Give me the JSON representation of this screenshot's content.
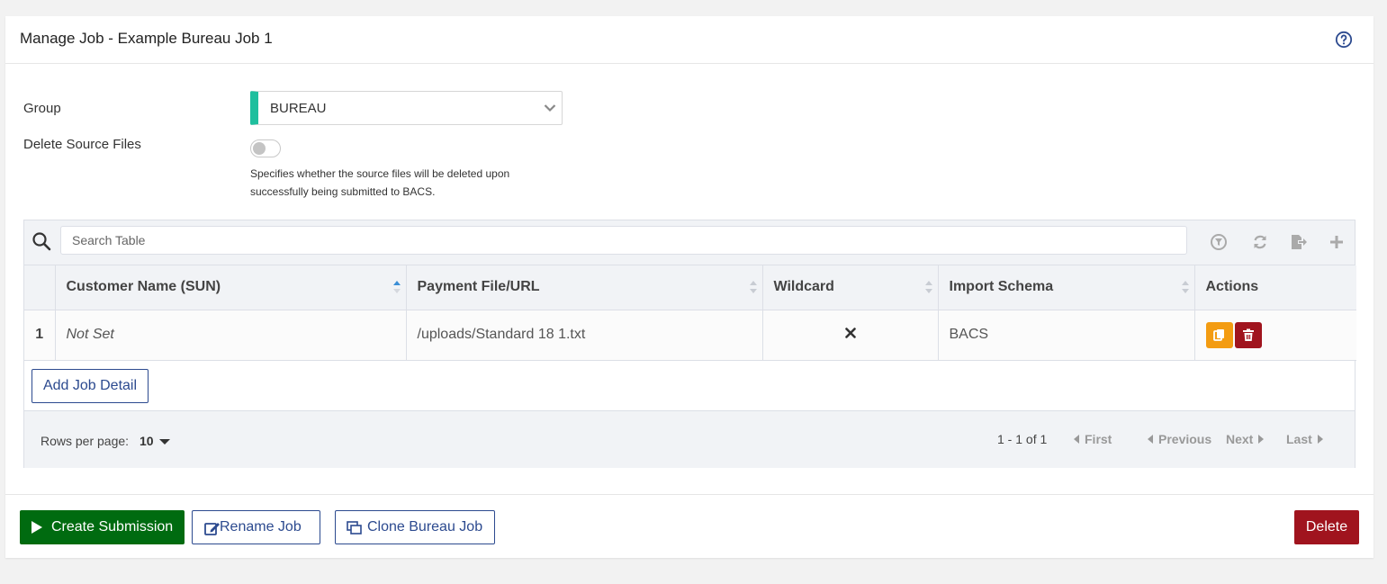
{
  "header": {
    "title": "Manage Job - Example Bureau Job 1",
    "help_icon": "question-circle-icon"
  },
  "form": {
    "group_label": "Group",
    "group_value": "BUREAU",
    "group_accent": "#1fbf9e",
    "delete_source_label": "Delete Source Files",
    "delete_source_enabled": false,
    "delete_source_help": "Specifies whether the source files will be deleted upon successfully being submitted to BACS."
  },
  "table": {
    "search_placeholder": "Search Table",
    "toolbar_icons": [
      "clear-filter-icon",
      "refresh-icon",
      "export-icon",
      "add-icon"
    ],
    "columns": [
      "",
      "Customer Name (SUN)",
      "Payment File/URL",
      "Wildcard",
      "Import Schema",
      "Actions"
    ],
    "rows": [
      {
        "index": "1",
        "customer": "Not Set",
        "payment_file": "/uploads/Standard 18 1.txt",
        "wildcard": "✕",
        "schema": "BACS"
      }
    ],
    "add_label": "Add Job Detail",
    "rows_per_page_label": "Rows per page:",
    "rows_per_page_value": "10",
    "page_info": "1 - 1 of 1",
    "first": "First",
    "previous": "Previous",
    "next": "Next",
    "last": "Last"
  },
  "footer": {
    "create_submission": "Create Submission",
    "rename_job": "Rename Job",
    "clone_job": "Clone Bureau Job",
    "delete": "Delete"
  },
  "colors": {
    "primary_green": "#006b10",
    "danger_red": "#a0141e",
    "copy_orange": "#f39c12",
    "outline_blue": "#2c4a8f"
  }
}
